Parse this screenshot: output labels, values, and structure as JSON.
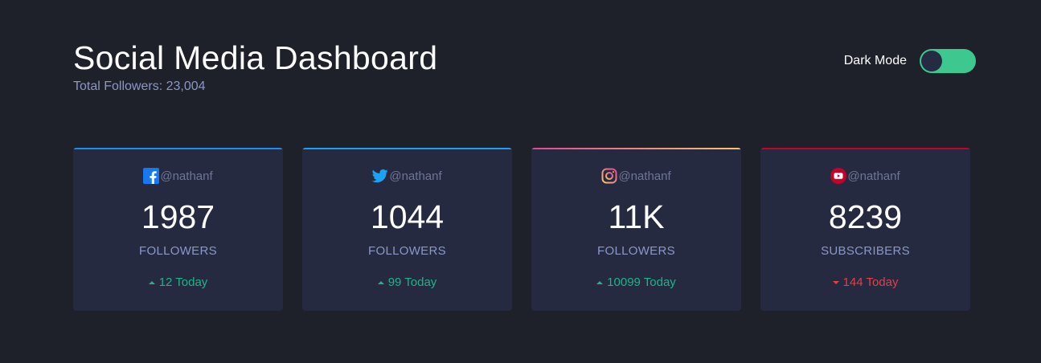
{
  "header": {
    "title": "Social Media Dashboard",
    "total_followers": "Total Followers: 23,004"
  },
  "toggle": {
    "label": "Dark Mode",
    "on": true,
    "track_color": "#3dc88f"
  },
  "colors": {
    "background": "#1e202a",
    "card": "#252a41",
    "up": "#1db489",
    "down": "#dc414c"
  },
  "cards": [
    {
      "platform": "facebook",
      "icon": "facebook-icon",
      "accent": "#198ff5",
      "handle": "@nathanf",
      "count": "1987",
      "label": "FOLLOWERS",
      "direction": "up",
      "today": "12 Today"
    },
    {
      "platform": "twitter",
      "icon": "twitter-icon",
      "accent": "#1ca0f2",
      "handle": "@nathanf",
      "count": "1044",
      "label": "FOLLOWERS",
      "direction": "up",
      "today": "99 Today"
    },
    {
      "platform": "instagram",
      "icon": "instagram-icon",
      "accent": "#df4996",
      "handle": "@nathanf",
      "count": "11K",
      "label": "FOLLOWERS",
      "direction": "up",
      "today": "10099 Today"
    },
    {
      "platform": "youtube",
      "icon": "youtube-icon",
      "accent": "#c4032a",
      "handle": "@nathanf",
      "count": "8239",
      "label": "SUBSCRIBERS",
      "direction": "down",
      "today": "144 Today"
    }
  ]
}
